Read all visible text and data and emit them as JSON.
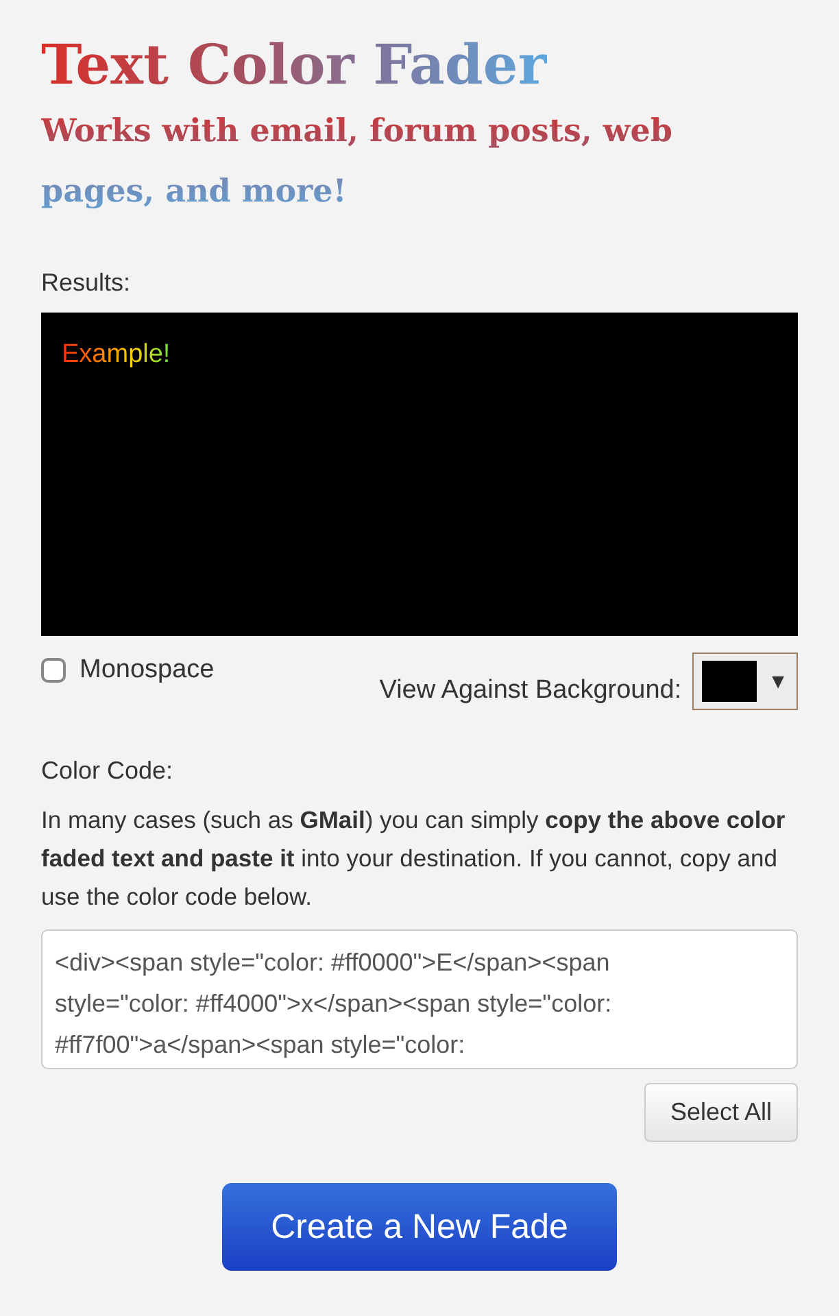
{
  "header": {
    "title": "Text Color Fader",
    "subtitle": "Works with email, forum posts, web pages, and more!"
  },
  "results": {
    "label": "Results:",
    "example": "Example!"
  },
  "options": {
    "monospace": {
      "label": "Monospace",
      "checked": false
    },
    "background_label": "View Against Background:",
    "dropdown_arrow": "▼"
  },
  "color_code": {
    "label": "Color Code:",
    "instructions": "In many cases (such as **GMail**) you can simply **copy the above color faded text and paste it** into your destination. If you cannot, copy and use the color code below.",
    "code": "<div><span style=\"color: #ff0000\">E</span><span style=\"color: #ff4000\">x</span><span style=\"color: #ff7f00\">a</span><span style=\"color:",
    "select_all": "Select All"
  },
  "create_button": "Create a New Fade"
}
